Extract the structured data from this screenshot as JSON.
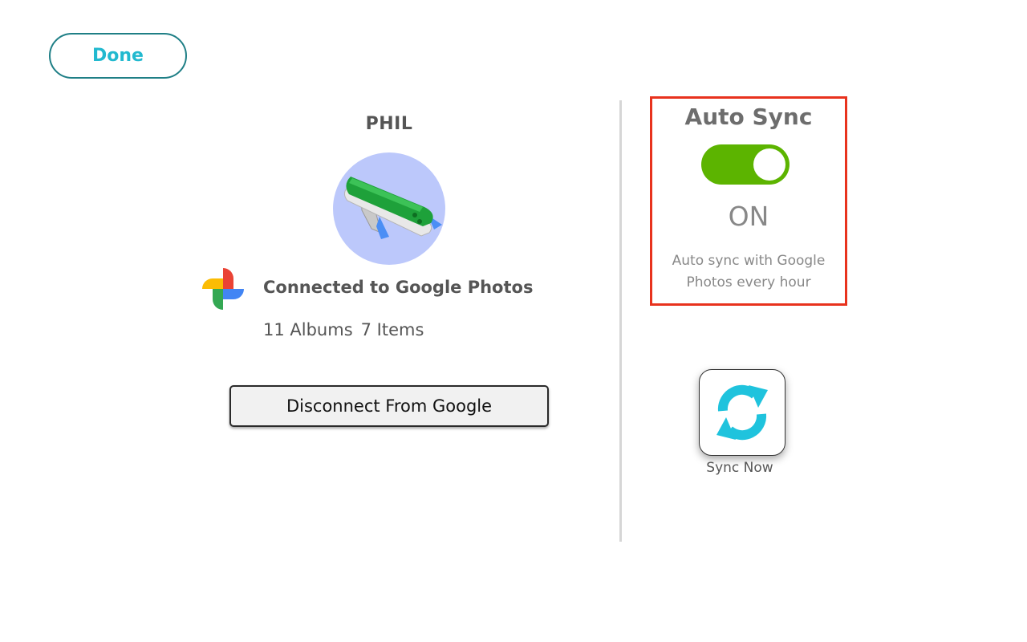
{
  "header": {
    "done_label": "Done"
  },
  "account": {
    "name": "PHIL",
    "avatar_icon": "swiss-knife-avatar",
    "service_icon": "google-photos-icon",
    "connected_text": "Connected to Google Photos",
    "albums": "11 Albums",
    "items": "7 Items",
    "disconnect_label": "Disconnect From Google"
  },
  "auto_sync": {
    "title": "Auto Sync",
    "enabled": true,
    "state_label": "ON",
    "description": "Auto sync with Google Photos every hour",
    "toggle_color": "#5cb400",
    "highlight_color": "#e8321d"
  },
  "sync_now": {
    "icon": "sync-icon",
    "label": "Sync Now",
    "icon_color": "#1fc3dd"
  },
  "colors": {
    "done_border": "#1f7f86",
    "done_text": "#22b9cf",
    "avatar_bg": "#bcc8fb"
  }
}
